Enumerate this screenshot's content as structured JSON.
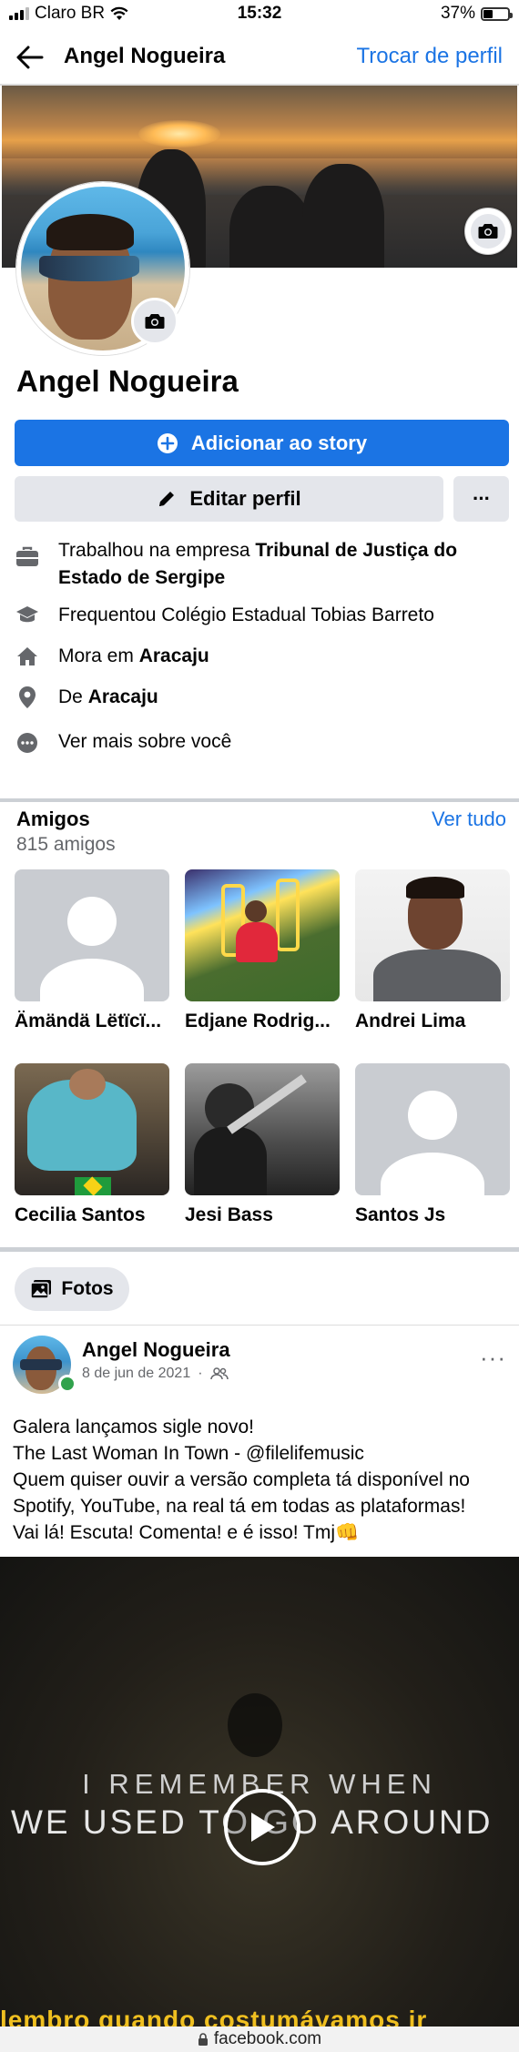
{
  "status_bar": {
    "carrier": "Claro BR",
    "time": "15:32",
    "battery": "37%"
  },
  "header": {
    "title": "Angel Nogueira",
    "switch_profile": "Trocar de perfil"
  },
  "profile": {
    "name": "Angel Nogueira",
    "add_story": "Adicionar ao story",
    "edit_profile": "Editar perfil",
    "more": "···"
  },
  "intro": {
    "work_prefix": "Trabalhou na empresa ",
    "work_place": "Tribunal de Justiça do Estado de Sergipe",
    "school": "Frequentou Colégio Estadual Tobias Barreto",
    "lives_prefix": "Mora em ",
    "lives_city": "Aracaju",
    "from_prefix": "De ",
    "from_city": "Aracaju",
    "see_more": "Ver mais sobre você"
  },
  "friends": {
    "title": "Amigos",
    "count": "815 amigos",
    "see_all": "Ver tudo",
    "items": [
      {
        "name": "Ämändä Lëtïcï..."
      },
      {
        "name": "Edjane Rodrig..."
      },
      {
        "name": "Andrei Lima"
      },
      {
        "name": "Cecilia Santos"
      },
      {
        "name": "Jesi Bass"
      },
      {
        "name": "Santos Js"
      }
    ]
  },
  "photos": {
    "label": "Fotos"
  },
  "post": {
    "author": "Angel Nogueira",
    "date": "8 de jun de 2021",
    "separator": "·",
    "more": "···",
    "lines": [
      "Galera lançamos sigle novo!",
      "The Last Woman In Town - @filelifemusic",
      "Quem quiser ouvir a versão completa tá disponível no",
      "Spotify, YouTube, na real tá em todas as plataformas!",
      "Vai lá! Escuta! Comenta! e é isso! Tmj👊"
    ],
    "video": {
      "line1": "I REMEMBER WHEN",
      "line2": "WE USED TO GO AROUND",
      "subtitle": "lembro quando costumávamos ir"
    }
  },
  "browser": {
    "url": "facebook.com"
  }
}
